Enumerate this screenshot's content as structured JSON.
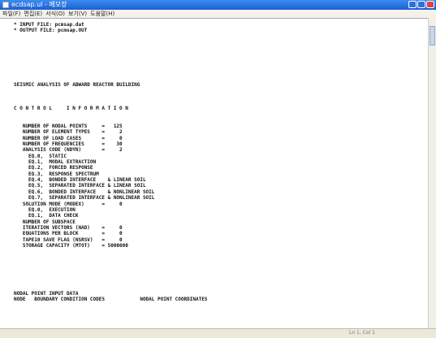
{
  "window": {
    "title": "ecdsap.ul - 메모장"
  },
  "menu": [
    "파일(F)",
    "편집(E)",
    "서식(O)",
    "보기(V)",
    "도움말(H)"
  ],
  "lines": [
    "* INPUT FILE: pcmsap.dat",
    "* OUTPUT FILE: pcmsap.OUT",
    "",
    "",
    "",
    "",
    "",
    "",
    "",
    "",
    "SEISMIC ANALYSIS OF ABWARD REACTOR BUILDING",
    "",
    "",
    "",
    "C O N T R O L     I N F O R M A T I O N",
    "",
    "",
    "   NUMBER OF NODAL POINTS     =   125",
    "   NUMBER OF ELEMENT TYPES    =     2",
    "   NUMBER OF LOAD CASES       =     0",
    "   NUMBER OF FREQUENCIES      =    30",
    "   ANALYSIS CODE (NDYN)       =     2",
    "     EQ.0,  STATIC",
    "     EQ.1,  MODAL EXTRACTION",
    "     EQ.2,  FORCED RESPONSE",
    "     EQ.3,  RESPONSE SPECTRUM",
    "     EQ.4,  BONDED INTERFACE    & LINEAR SOIL",
    "     EQ.5,  SEPARATED INTERFACE & LINEAR SOIL",
    "     EQ.6,  BONDED INTERFACE    & NONLINEAR SOIL",
    "     EQ.7,  SEPARATED INTERFACE & NONLINEAR SOIL",
    "   SOLUTION MODE (MODEX)      =     0",
    "     EQ.0,  EXECUTION",
    "     EQ.1,  DATA CHECK",
    "   NUMBER OF SUBSPACE",
    "   ITERATION VECTORS (NAD)    =     0",
    "   EQUATIONS PER BLOCK        =     0",
    "   TAPE10 SAVE FLAG (NSRSV)   =     0",
    "   STORAGE CAPACITY (MTOT)    = 5000000",
    "",
    "",
    "",
    "",
    "",
    "",
    "",
    "NODAL POINT INPUT DATA",
    "NODE   BOUNDARY CONDITION CODES            NODAL POINT COORDINATES"
  ],
  "status": {
    "position": "Ln 1, Col 1"
  }
}
